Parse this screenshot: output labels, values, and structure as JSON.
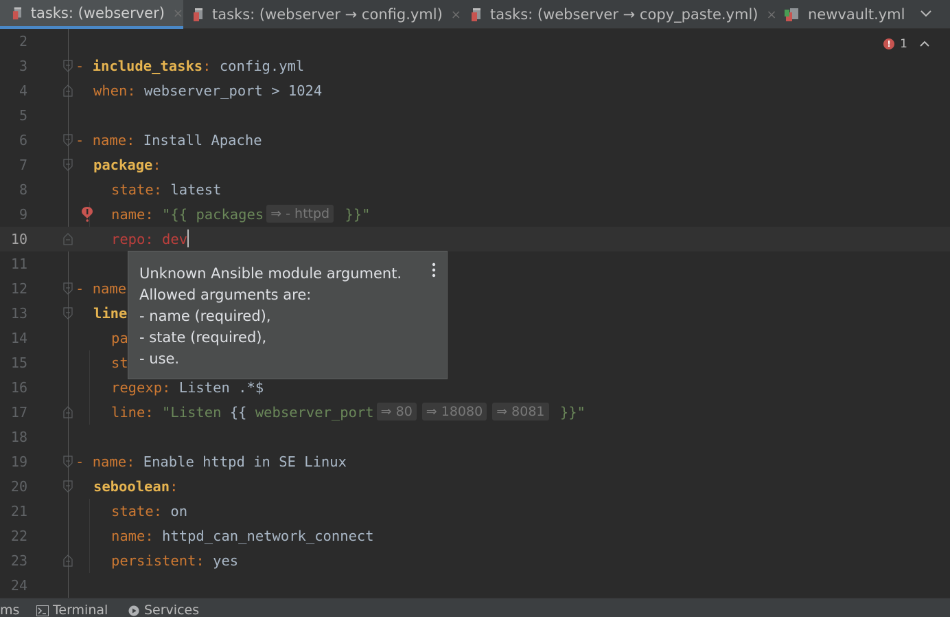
{
  "tabs": [
    {
      "label": "tasks: (webserver)",
      "active": true,
      "closable": true
    },
    {
      "label": "tasks: (webserver → config.yml)",
      "active": false,
      "closable": true
    },
    {
      "label": "tasks: (webserver → copy_paste.yml)",
      "active": false,
      "closable": true
    },
    {
      "label": "newvault.yml",
      "active": false,
      "closable": false
    }
  ],
  "tab_close_glyph": "×",
  "problems": {
    "error_count": "1",
    "icon": "error-icon"
  },
  "lines": [
    {
      "n": "2"
    },
    {
      "n": "3"
    },
    {
      "n": "4"
    },
    {
      "n": "5"
    },
    {
      "n": "6"
    },
    {
      "n": "7"
    },
    {
      "n": "8"
    },
    {
      "n": "9"
    },
    {
      "n": "10"
    },
    {
      "n": "11"
    },
    {
      "n": "12"
    },
    {
      "n": "13"
    },
    {
      "n": "14"
    },
    {
      "n": "15"
    },
    {
      "n": "16"
    },
    {
      "n": "17"
    },
    {
      "n": "18"
    },
    {
      "n": "19"
    },
    {
      "n": "20"
    },
    {
      "n": "21"
    },
    {
      "n": "22"
    },
    {
      "n": "23"
    },
    {
      "n": "24"
    }
  ],
  "code": {
    "dash": "- ",
    "l3": {
      "key": "include_tasks",
      "colon": ":",
      "value": " config.yml"
    },
    "l4": {
      "key": "when",
      "colon": ":",
      "value": " webserver_port > 1024"
    },
    "l6": {
      "key": "name",
      "colon": ":",
      "value": " Install Apache"
    },
    "l7": {
      "key": "package",
      "colon": ":"
    },
    "l8": {
      "key": "state",
      "colon": ":",
      "value": " latest"
    },
    "l9": {
      "key": "name",
      "colon": ":",
      "pre": " \"{{ ",
      "var": "packages",
      "hint": "⇒ - httpd",
      "post": " }}\""
    },
    "l10": {
      "key": "repo",
      "colon": ":",
      "value": " dev"
    },
    "l12": {
      "key": "name"
    },
    "l13": {
      "key": "line"
    },
    "l14": {
      "key": "pa"
    },
    "l15": {
      "key": "st"
    },
    "l16": {
      "key": "regexp",
      "colon": ":",
      "value": " Listen .*$"
    },
    "l17": {
      "key": "line",
      "colon": ":",
      "pre": " \"Listen ",
      "brace_open": "{{ ",
      "var": "webserver_port",
      "hints": [
        "⇒ 80",
        "⇒ 18080",
        "⇒ 8081"
      ],
      "post": " }}\""
    },
    "l19": {
      "key": "name",
      "colon": ":",
      "value": " Enable httpd in SE Linux"
    },
    "l20": {
      "key": "seboolean",
      "colon": ":"
    },
    "l21": {
      "key": "state",
      "colon": ":",
      "value": " on"
    },
    "l22": {
      "key": "name",
      "colon": ":",
      "value": " httpd_can_network_connect"
    },
    "l23": {
      "key": "persistent",
      "colon": ":",
      "value": " yes"
    }
  },
  "tooltip": {
    "lines": [
      "Unknown Ansible module argument.",
      "Allowed arguments are:",
      "- name (required),",
      "- state (required),",
      "- use."
    ],
    "menu_icon": "more-vertical-icon"
  },
  "bottom": {
    "problems_fragment": "ms",
    "terminal": "Terminal",
    "services": "Services"
  },
  "colors": {
    "background": "#2b2b2b",
    "keyword": "#cc7832",
    "string": "#6a8759",
    "error": "#bc3f3c",
    "accent": "#4a88c7"
  }
}
